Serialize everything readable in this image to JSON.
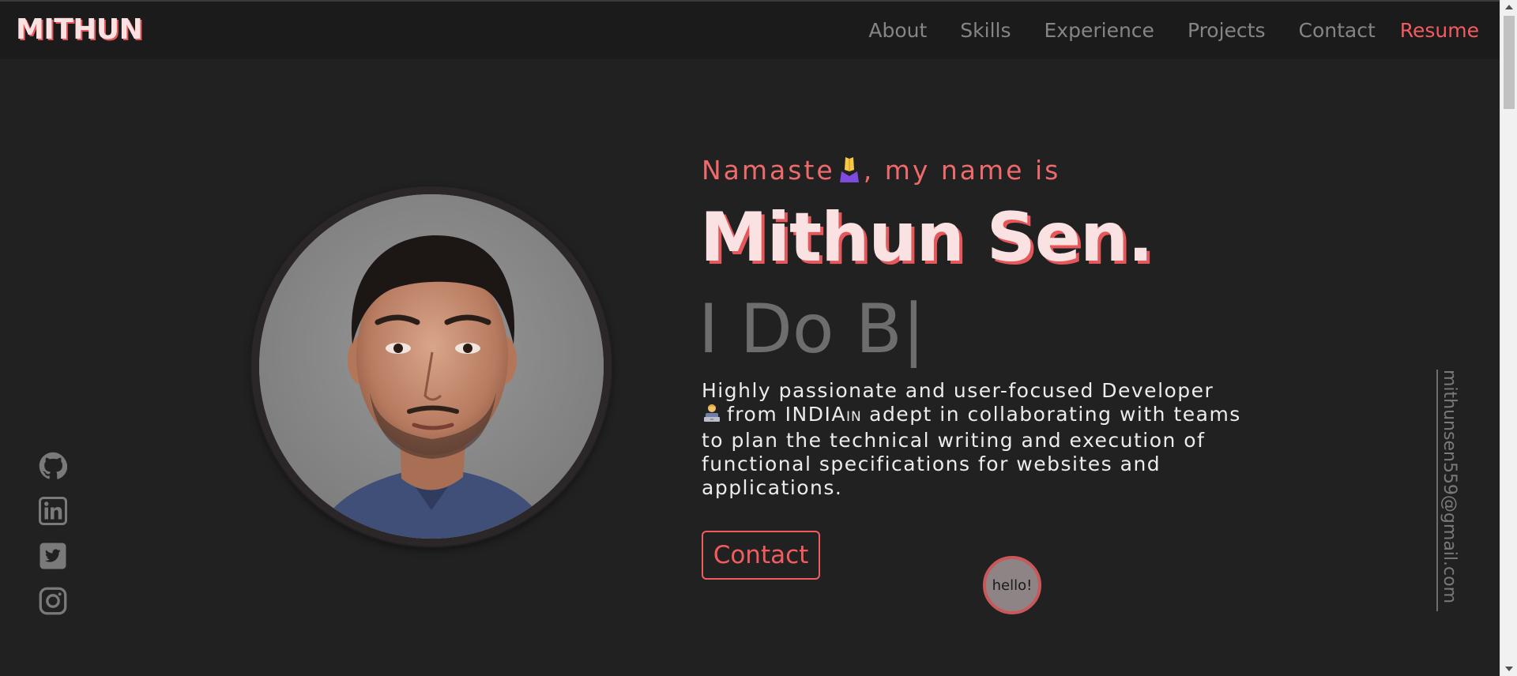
{
  "header": {
    "logo": "MITHUN",
    "nav": [
      {
        "label": "About"
      },
      {
        "label": "Skills"
      },
      {
        "label": "Experience"
      },
      {
        "label": "Projects"
      },
      {
        "label": "Contact"
      }
    ],
    "resume_label": "Resume"
  },
  "hero": {
    "greeting_prefix": "Namaste",
    "greeting_suffix": ", my name is",
    "name": "Mithun Sen.",
    "typing_text": "I Do B|",
    "intro_line1": "Highly passionate and user-focused Developer",
    "intro_line2_pre": "from INDIA",
    "intro_flag": "IN",
    "intro_line2_post": " adept in collaborating with teams to plan the technical writing and execution of functional specifications for websites and applications.",
    "contact_button": "Contact",
    "hello_bubble": "hello!"
  },
  "sidebar": {
    "email": "mithunsen559@gmail.com",
    "social": [
      "github-icon",
      "linkedin-icon",
      "twitter-icon",
      "instagram-icon"
    ]
  },
  "colors": {
    "background": "#212121",
    "navbar": "#1c1b1c",
    "accent": "#f25c5f",
    "name_fill": "#fbe2e2",
    "muted": "#858585"
  }
}
